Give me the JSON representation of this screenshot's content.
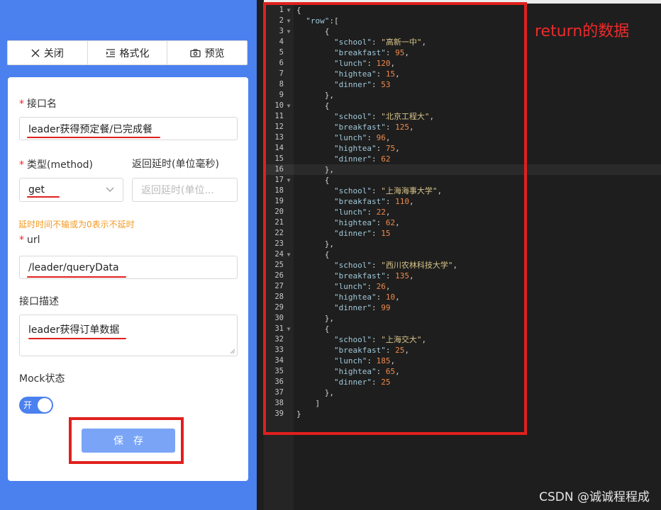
{
  "toolbar": {
    "close_label": "关闭",
    "close_icon": "close-icon",
    "format_label": "格式化",
    "format_icon": "indent-icon",
    "preview_label": "预览",
    "preview_icon": "camera-icon"
  },
  "form": {
    "name_label": "接口名",
    "name_value": "leader获得预定餐/已完成餐",
    "type_label": "类型(method)",
    "type_value": "get",
    "delay_label": "返回延时(单位毫秒)",
    "delay_placeholder": "返回延时(单位...",
    "delay_hint": "延时时间不输或为0表示不延时",
    "url_label": "url",
    "url_value": "/leader/queryData",
    "desc_label": "接口描述",
    "desc_value": "leader获得订单数据",
    "mock_label": "Mock状态",
    "mock_toggle_text": "开",
    "mock_on": true,
    "save_label": "保存"
  },
  "editor": {
    "annotation": "return的数据",
    "lines": [
      [
        [
          "p",
          "{"
        ]
      ],
      [
        [
          "p",
          "  "
        ],
        [
          "k",
          "\"row\""
        ],
        [
          "p",
          ":["
        ]
      ],
      [
        [
          "p",
          "      {"
        ]
      ],
      [
        [
          "p",
          "        "
        ],
        [
          "k",
          "\"school\""
        ],
        [
          "p",
          ": "
        ],
        [
          "s",
          "\"高新一中\""
        ],
        [
          "p",
          ","
        ]
      ],
      [
        [
          "p",
          "        "
        ],
        [
          "k",
          "\"breakfast\""
        ],
        [
          "p",
          ": "
        ],
        [
          "n",
          "95"
        ],
        [
          "p",
          ","
        ]
      ],
      [
        [
          "p",
          "        "
        ],
        [
          "k",
          "\"lunch\""
        ],
        [
          "p",
          ": "
        ],
        [
          "n",
          "120"
        ],
        [
          "p",
          ","
        ]
      ],
      [
        [
          "p",
          "        "
        ],
        [
          "k",
          "\"hightea\""
        ],
        [
          "p",
          ": "
        ],
        [
          "n",
          "15"
        ],
        [
          "p",
          ","
        ]
      ],
      [
        [
          "p",
          "        "
        ],
        [
          "k",
          "\"dinner\""
        ],
        [
          "p",
          ": "
        ],
        [
          "n",
          "53"
        ]
      ],
      [
        [
          "p",
          "      },"
        ]
      ],
      [
        [
          "p",
          "      {"
        ]
      ],
      [
        [
          "p",
          "        "
        ],
        [
          "k",
          "\"school\""
        ],
        [
          "p",
          ": "
        ],
        [
          "s",
          "\"北京工程大\""
        ],
        [
          "p",
          ","
        ]
      ],
      [
        [
          "p",
          "        "
        ],
        [
          "k",
          "\"breakfast\""
        ],
        [
          "p",
          ": "
        ],
        [
          "n",
          "125"
        ],
        [
          "p",
          ","
        ]
      ],
      [
        [
          "p",
          "        "
        ],
        [
          "k",
          "\"lunch\""
        ],
        [
          "p",
          ": "
        ],
        [
          "n",
          "96"
        ],
        [
          "p",
          ","
        ]
      ],
      [
        [
          "p",
          "        "
        ],
        [
          "k",
          "\"hightea\""
        ],
        [
          "p",
          ": "
        ],
        [
          "n",
          "75"
        ],
        [
          "p",
          ","
        ]
      ],
      [
        [
          "p",
          "        "
        ],
        [
          "k",
          "\"dinner\""
        ],
        [
          "p",
          ": "
        ],
        [
          "n",
          "62"
        ]
      ],
      [
        [
          "p",
          "      },"
        ]
      ],
      [
        [
          "p",
          "      {"
        ]
      ],
      [
        [
          "p",
          "        "
        ],
        [
          "k",
          "\"school\""
        ],
        [
          "p",
          ": "
        ],
        [
          "s",
          "\"上海海事大学\""
        ],
        [
          "p",
          ","
        ]
      ],
      [
        [
          "p",
          "        "
        ],
        [
          "k",
          "\"breakfast\""
        ],
        [
          "p",
          ": "
        ],
        [
          "n",
          "110"
        ],
        [
          "p",
          ","
        ]
      ],
      [
        [
          "p",
          "        "
        ],
        [
          "k",
          "\"lunch\""
        ],
        [
          "p",
          ": "
        ],
        [
          "n",
          "22"
        ],
        [
          "p",
          ","
        ]
      ],
      [
        [
          "p",
          "        "
        ],
        [
          "k",
          "\"hightea\""
        ],
        [
          "p",
          ": "
        ],
        [
          "n",
          "62"
        ],
        [
          "p",
          ","
        ]
      ],
      [
        [
          "p",
          "        "
        ],
        [
          "k",
          "\"dinner\""
        ],
        [
          "p",
          ": "
        ],
        [
          "n",
          "15"
        ]
      ],
      [
        [
          "p",
          "      },"
        ]
      ],
      [
        [
          "p",
          "      {"
        ]
      ],
      [
        [
          "p",
          "        "
        ],
        [
          "k",
          "\"school\""
        ],
        [
          "p",
          ": "
        ],
        [
          "s",
          "\"西川农林科技大学\""
        ],
        [
          "p",
          ","
        ]
      ],
      [
        [
          "p",
          "        "
        ],
        [
          "k",
          "\"breakfast\""
        ],
        [
          "p",
          ": "
        ],
        [
          "n",
          "135"
        ],
        [
          "p",
          ","
        ]
      ],
      [
        [
          "p",
          "        "
        ],
        [
          "k",
          "\"lunch\""
        ],
        [
          "p",
          ": "
        ],
        [
          "n",
          "26"
        ],
        [
          "p",
          ","
        ]
      ],
      [
        [
          "p",
          "        "
        ],
        [
          "k",
          "\"hightea\""
        ],
        [
          "p",
          ": "
        ],
        [
          "n",
          "10"
        ],
        [
          "p",
          ","
        ]
      ],
      [
        [
          "p",
          "        "
        ],
        [
          "k",
          "\"dinner\""
        ],
        [
          "p",
          ": "
        ],
        [
          "n",
          "99"
        ]
      ],
      [
        [
          "p",
          "      },"
        ]
      ],
      [
        [
          "p",
          "      {"
        ]
      ],
      [
        [
          "p",
          "        "
        ],
        [
          "k",
          "\"school\""
        ],
        [
          "p",
          ": "
        ],
        [
          "s",
          "\"上海交大\""
        ],
        [
          "p",
          ","
        ]
      ],
      [
        [
          "p",
          "        "
        ],
        [
          "k",
          "\"breakfast\""
        ],
        [
          "p",
          ": "
        ],
        [
          "n",
          "25"
        ],
        [
          "p",
          ","
        ]
      ],
      [
        [
          "p",
          "        "
        ],
        [
          "k",
          "\"lunch\""
        ],
        [
          "p",
          ": "
        ],
        [
          "n",
          "185"
        ],
        [
          "p",
          ","
        ]
      ],
      [
        [
          "p",
          "        "
        ],
        [
          "k",
          "\"hightea\""
        ],
        [
          "p",
          ": "
        ],
        [
          "n",
          "65"
        ],
        [
          "p",
          ","
        ]
      ],
      [
        [
          "p",
          "        "
        ],
        [
          "k",
          "\"dinner\""
        ],
        [
          "p",
          ": "
        ],
        [
          "n",
          "25"
        ]
      ],
      [
        [
          "p",
          "      },"
        ]
      ],
      [
        [
          "p",
          "    ]"
        ]
      ],
      [
        [
          "p",
          "}"
        ]
      ]
    ],
    "foldable_lines": [
      1,
      2,
      3,
      10,
      17,
      24,
      31
    ]
  },
  "watermark": "CSDN @诚诚程程成"
}
